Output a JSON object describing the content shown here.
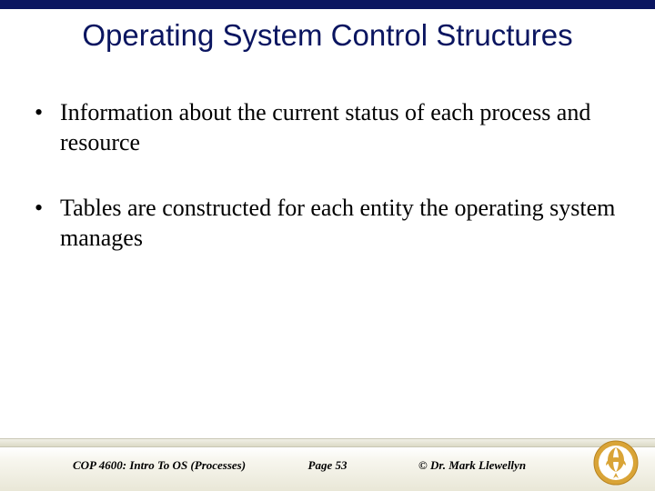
{
  "title": "Operating System Control Structures",
  "bullets": [
    "Information about the current status of each process and resource",
    "Tables are constructed for each entity the operating system manages"
  ],
  "footer": {
    "course": "COP 4600: Intro To OS  (Processes)",
    "page": "Page 53",
    "copyright": "© Dr. Mark Llewellyn"
  },
  "colors": {
    "accent": "#0a1560",
    "logo_gold": "#d9a437"
  }
}
